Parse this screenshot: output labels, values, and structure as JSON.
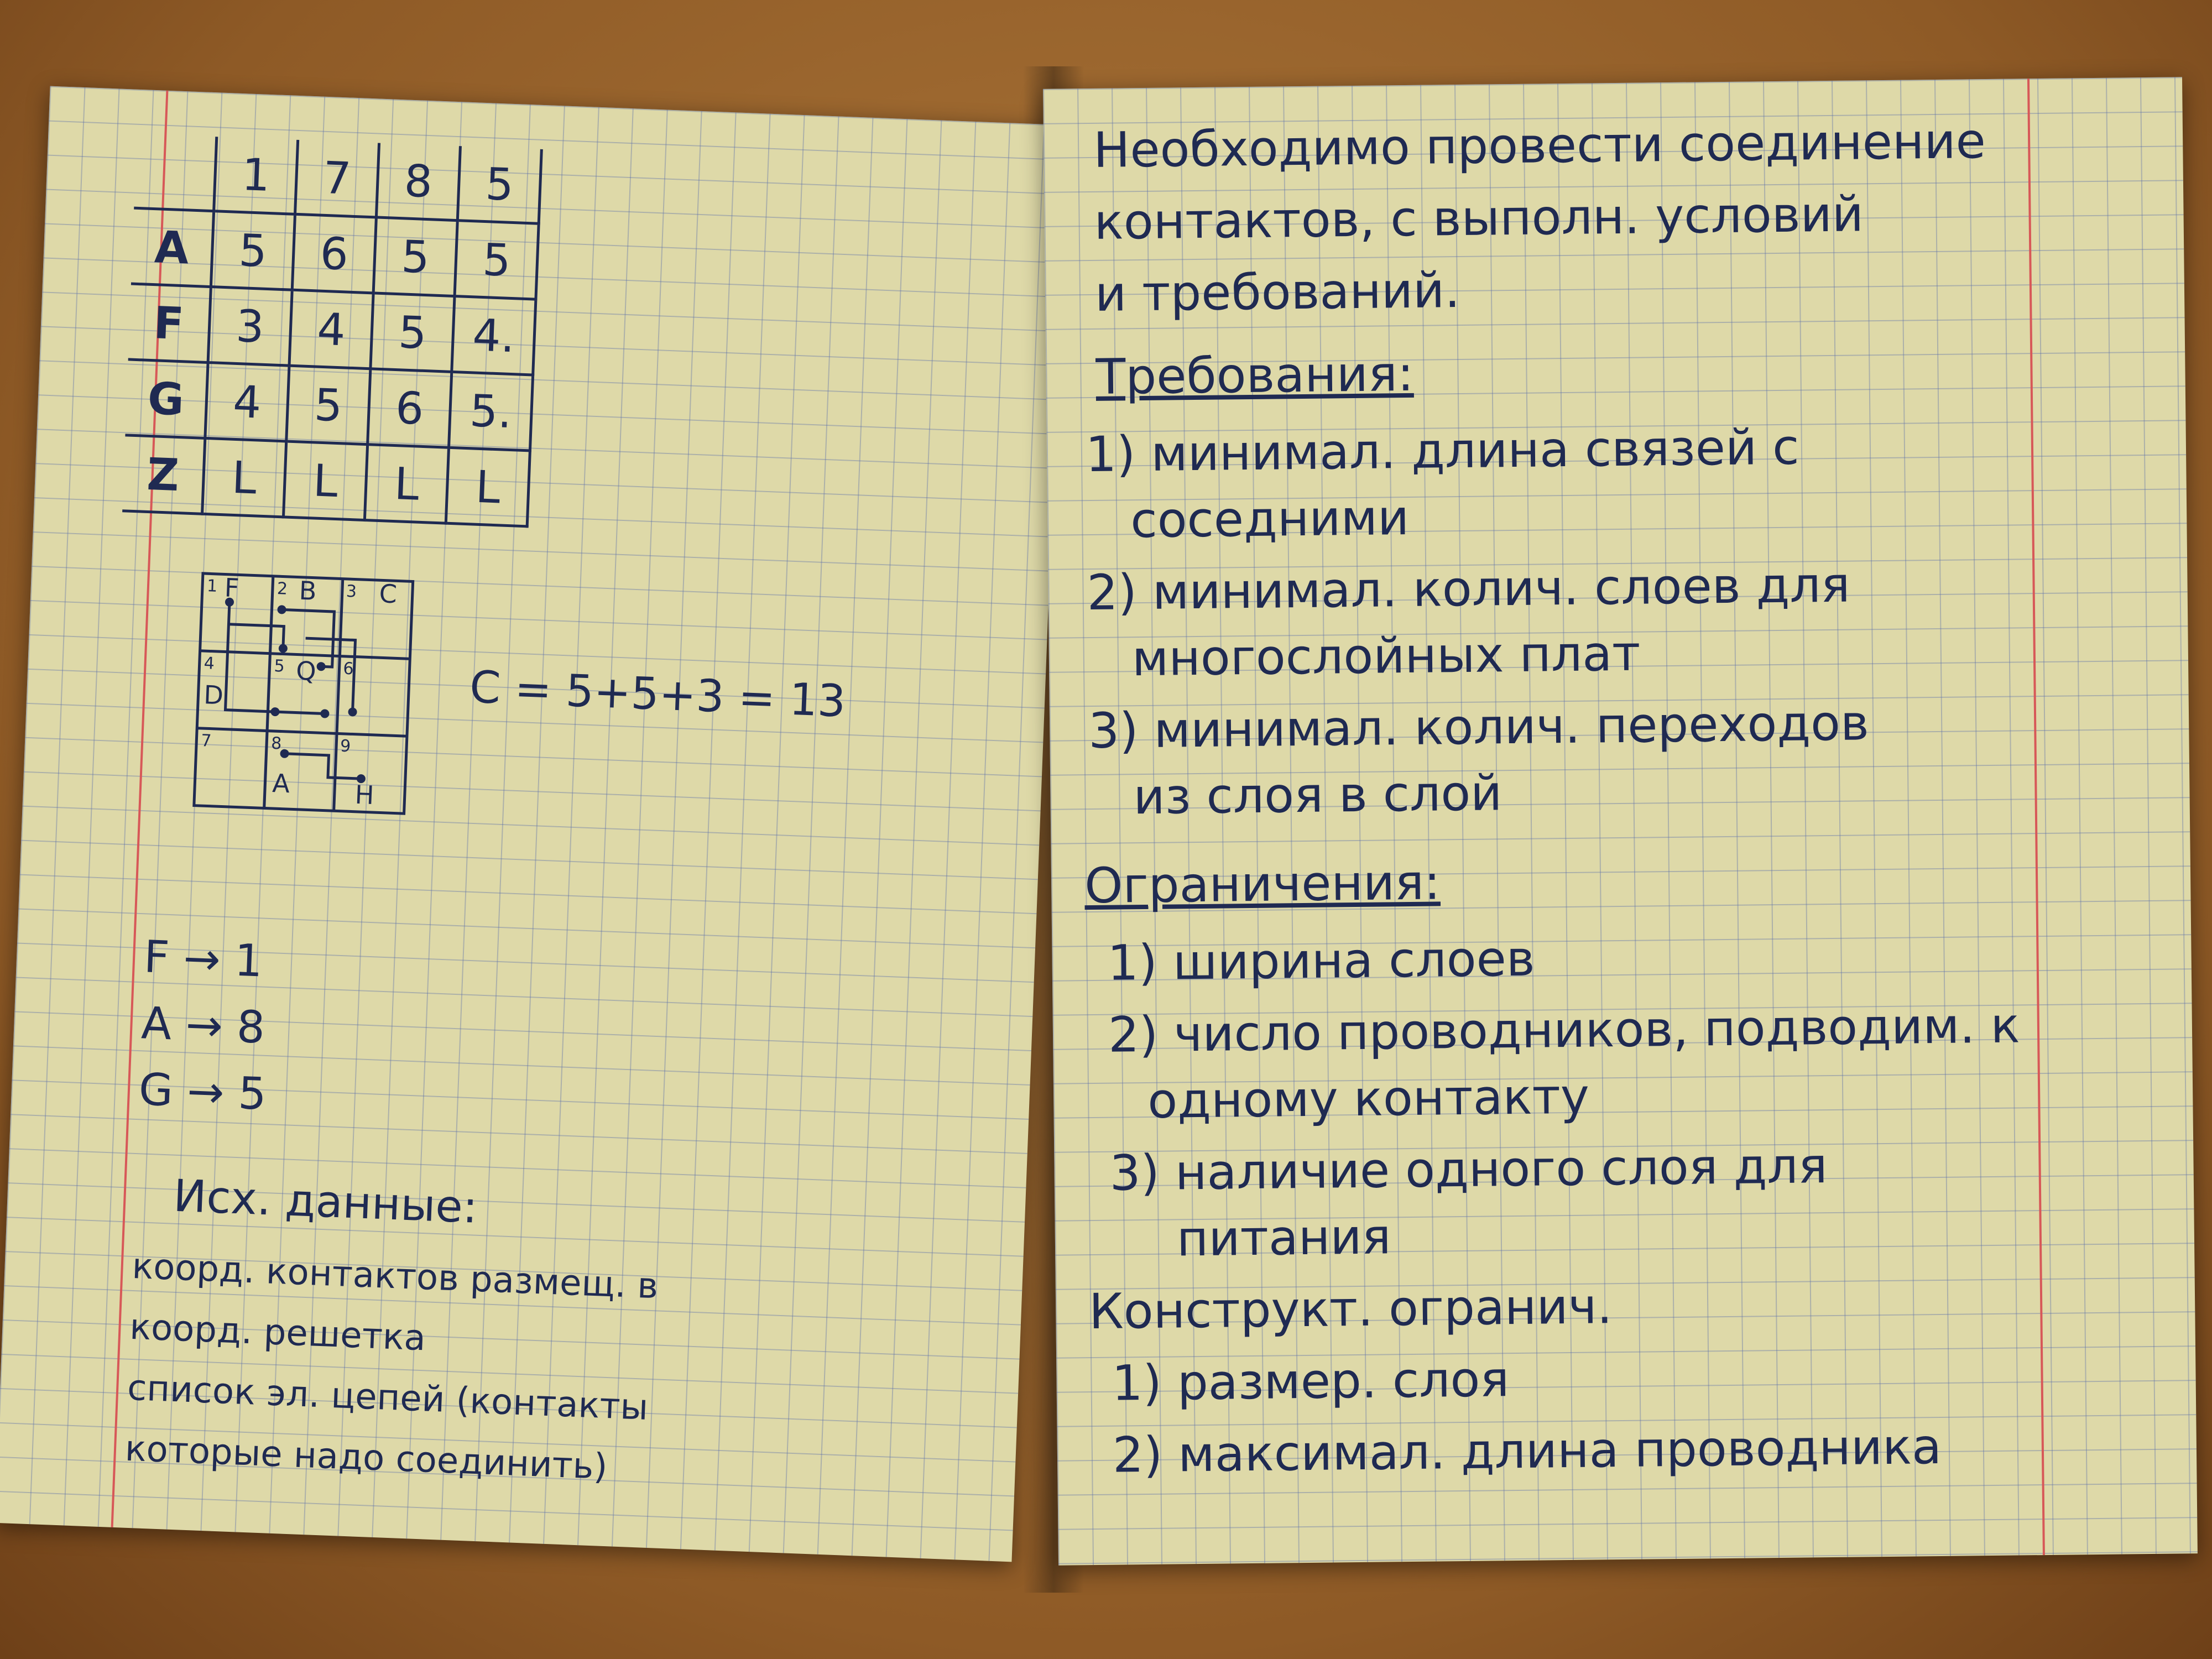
{
  "left_page": {
    "matrix": {
      "col_headers": [
        "1",
        "7",
        "8",
        "5"
      ],
      "rows": [
        {
          "label": "A",
          "cells": [
            "5",
            "6",
            "5",
            "5"
          ]
        },
        {
          "label": "F",
          "cells": [
            "3",
            "4",
            "5",
            "4."
          ]
        },
        {
          "label": "G",
          "cells": [
            "4",
            "5",
            "6",
            "5."
          ]
        },
        {
          "label": "Z",
          "cells": [
            "L",
            "L",
            "L",
            "L"
          ]
        }
      ]
    },
    "board": {
      "cell_numbers": [
        "1",
        "2",
        "3",
        "4",
        "5",
        "6",
        "7",
        "8",
        "9"
      ],
      "letters": {
        "F": "F",
        "B": "B",
        "C": "C",
        "Q": "Q",
        "D": "D",
        "A": "A",
        "H": "H"
      }
    },
    "formula": "C = 5+5+3 = 13",
    "assignments": [
      "F → 1",
      "A → 8",
      "G → 5"
    ],
    "notes": {
      "heading": "Исх. данные:",
      "lines": [
        "коорд. контактов размещ. в",
        "коорд. решетка",
        "список эл. цепей (контакты",
        "которые надо соединить)"
      ]
    }
  },
  "right_page": {
    "intro": [
      "Необходимо провести соединение",
      "контактов, с выполн. условий",
      "и требований."
    ],
    "requirements": {
      "heading": "Требования:",
      "items": [
        "1) минимал. длина связей с",
        "соседними",
        "2) минимал. колич. слоев для",
        "многослойных плат",
        "3) минимал. колич. переходов",
        "из слоя в слой"
      ]
    },
    "constraints": {
      "heading": "Ограничения:",
      "items": [
        "1) ширина слоев",
        "2) число проводников, подводим. к",
        "одному контакту",
        "3) наличие одного слоя для",
        "питания"
      ]
    },
    "constructive": {
      "heading": "Конструкт. огранич.",
      "items": [
        "1) размер. слоя",
        "2) максимал. длина проводника"
      ]
    }
  }
}
